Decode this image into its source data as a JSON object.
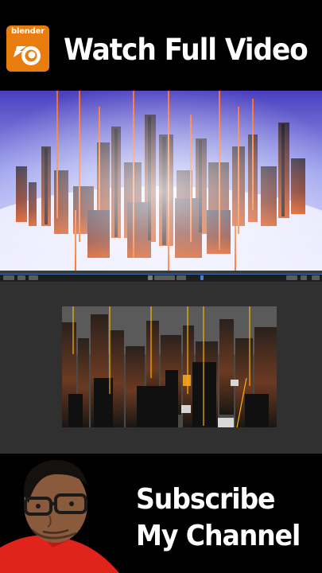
{
  "brand": {
    "logo_text": "blender",
    "logo_color": "#e87d0d"
  },
  "header": {
    "headline": "Watch Full Video"
  },
  "footer": {
    "line1": "Subscribe",
    "line2": "My Channel"
  },
  "colors": {
    "background": "#000000",
    "ui_panel": "#303030",
    "accent_neon": "#ff6a1a",
    "haze": "#c9c6ff"
  },
  "icons": {
    "logo": "blender-logo-icon"
  }
}
